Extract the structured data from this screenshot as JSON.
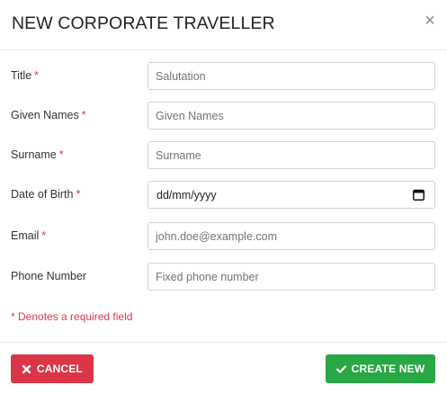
{
  "modal": {
    "title": "NEW CORPORATE TRAVELLER",
    "close_icon": "close-icon"
  },
  "form": {
    "fields": [
      {
        "label": "Title",
        "required": true,
        "placeholder": "Salutation"
      },
      {
        "label": "Given Names",
        "required": true,
        "placeholder": "Given Names"
      },
      {
        "label": "Surname",
        "required": true,
        "placeholder": "Surname"
      },
      {
        "label": "Date of Birth",
        "required": true,
        "value": "dd/mm/yyyy"
      },
      {
        "label": "Email",
        "required": true,
        "placeholder": "john.doe@example.com"
      },
      {
        "label": "Phone Number",
        "required": false,
        "placeholder": "Fixed phone number"
      }
    ],
    "required_marker": "*",
    "required_note": "* Denotes a required field"
  },
  "footer": {
    "cancel_label": "CANCEL",
    "create_label": "CREATE NEW"
  },
  "colors": {
    "cancel": "#dc3545",
    "create": "#28a745",
    "required": "#dc3545"
  }
}
